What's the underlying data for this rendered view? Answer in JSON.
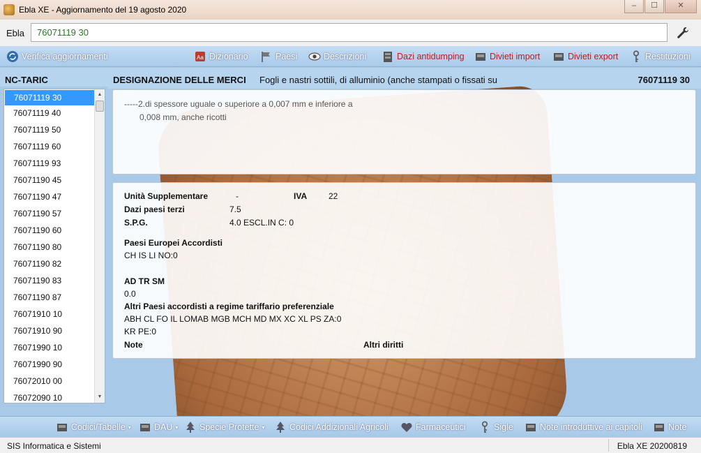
{
  "window": {
    "title": "Ebla XE - Aggiornamento del 19 agosto 2020",
    "minimize": "–",
    "maximize": "☐",
    "close": "✕"
  },
  "search": {
    "label": "Ebla",
    "value": "76071119 30"
  },
  "toolbar": {
    "verifica": "Verifica aggiornamenti",
    "dizionario": "Dizionario",
    "paesi": "Paesi",
    "descrizioni": "Descrizioni",
    "dazi_antidumping": "Dazi antidumping",
    "divieti_import": "Divieti import",
    "divieti_export": "Divieti export",
    "restituzioni": "Restituzioni"
  },
  "left": {
    "header": "NC-TARIC",
    "items": [
      "76071119 30",
      "76071119 40",
      "76071119 50",
      "76071119 60",
      "76071119 93",
      "76071190 45",
      "76071190 47",
      "76071190 57",
      "76071190 60",
      "76071190 80",
      "76071190 82",
      "76071190 83",
      "76071190 87",
      "76071910 10",
      "76071910 90",
      "76071990 10",
      "76071990 90",
      "76072010 00",
      "76072090 10"
    ]
  },
  "designation": {
    "title": "DESIGNAZIONE DELLE MERCI",
    "text": "Fogli e nastri sottili, di alluminio (anche stampati o fissati su",
    "code": "76071119 30",
    "line1": "-----2.di spessore uguale o superiore a 0,007 mm e inferiore a",
    "line2": "0,008 mm, anche ricotti"
  },
  "details": {
    "unita_label": "Unità Supplementare",
    "unita_value": "-",
    "iva_label": "IVA",
    "iva_value": "22",
    "dazi_label": "Dazi paesi terzi",
    "dazi_value": "7.5",
    "spg_label": "S.P.G.",
    "spg_value": "4.0  ESCL.IN  C: 0",
    "paesi_eu_label": "Paesi Europei Accordisti",
    "paesi_eu_value": "CH IS LI NO:0",
    "adtrsm_label": "AD TR SM",
    "adtrsm_value": "0.0",
    "altri_label": "Altri Paesi accordisti a regime tariffario preferenziale",
    "altri_value1": "ABH CL FO IL LOMAB MGB MCH MD MX XC XL PS ZA:0",
    "altri_value2": "KR PE:0",
    "note_label": "Note",
    "diritti_label": "Altri diritti"
  },
  "bottombar": {
    "codici_tabelle": "Codici/Tabelle",
    "dau": "DAU",
    "specie": "Specie Protette",
    "agricoli": "Codici Addizionali Agricoli",
    "farmaceutici": "Farmaceutici",
    "sigle": "Sigle",
    "note_intro": "Note introduttive ai capitoli",
    "note": "Note"
  },
  "status": {
    "left": "SIS Informatica e Sistemi",
    "right": "Ebla XE 20200819"
  },
  "colors": {
    "accent": "#3399ff",
    "toolbar": "#a9cbea",
    "red_label": "#b0221e",
    "input_text": "#2a7a2a"
  }
}
